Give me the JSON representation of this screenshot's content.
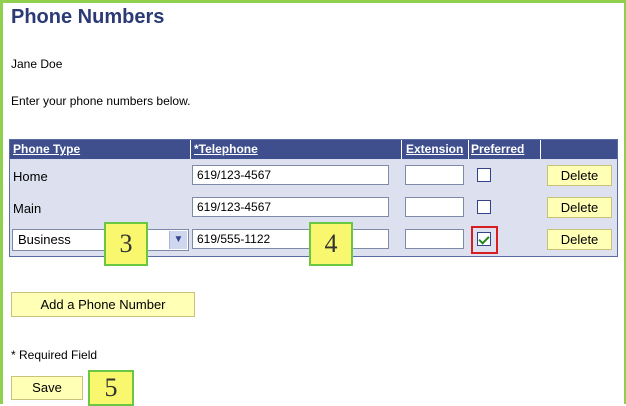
{
  "page": {
    "title": "Phone Numbers",
    "person_name": "Jane Doe",
    "instruction": "Enter your phone numbers below."
  },
  "table": {
    "headers": {
      "phone_type": "Phone Type",
      "telephone": "*Telephone",
      "extension": "Extension",
      "preferred": "Preferred"
    },
    "rows": [
      {
        "type": "Home",
        "telephone": "619/123-4567",
        "extension": "",
        "preferred": false,
        "delete_label": "Delete"
      },
      {
        "type": "Main",
        "telephone": "619/123-4567",
        "extension": "",
        "preferred": false,
        "delete_label": "Delete"
      },
      {
        "type": "Business",
        "telephone": "619/555-1122",
        "extension": "",
        "preferred": true,
        "delete_label": "Delete"
      }
    ]
  },
  "buttons": {
    "add_phone": "Add a Phone Number",
    "save": "Save"
  },
  "required_note": "* Required Field",
  "callouts": {
    "c3": "3",
    "c4": "4",
    "c5": "5"
  },
  "colors": {
    "header_bg": "#3f4f8e",
    "row_bg": "#dde1ef",
    "button_bg": "#ffffb6",
    "callout_bg": "#f9f76e",
    "callout_border": "#69c744",
    "highlight": "#d81e1e"
  }
}
